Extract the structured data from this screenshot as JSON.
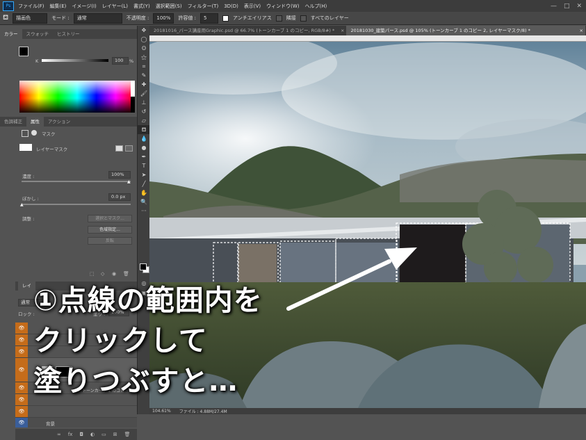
{
  "app": {
    "logo": "Ps",
    "menu": [
      "ファイル(F)",
      "編集(E)",
      "イメージ(I)",
      "レイヤー(L)",
      "書式(Y)",
      "選択範囲(S)",
      "フィルター(T)",
      "3D(D)",
      "表示(V)",
      "ウィンドウ(W)",
      "ヘルプ(H)"
    ],
    "window_buttons": [
      "—",
      "□",
      "✕"
    ]
  },
  "options": {
    "fill_source": "描画色",
    "mode_label": "モード :",
    "mode_value": "通常",
    "opacity_label": "不透明度 :",
    "opacity_value": "100%",
    "tolerance_label": "許容値 :",
    "tolerance_value": "5",
    "antialias_label": "アンチエイリアス",
    "contiguous_label": "隣接",
    "all_layers_label": "すべてのレイヤー"
  },
  "doc_tabs": [
    {
      "label": "20181016_パース講座用Graphic.psd @ 66.7% (トーンカーブ 1 のコピー, RGB/8#) *",
      "close": "×"
    },
    {
      "label": "20181030_建築パース.psd @ 105% (トーンカーブ 1 のコピー 2, レイヤーマスク/8) *",
      "close": "×"
    }
  ],
  "color_panel": {
    "tabs": [
      "カラー",
      "スウォッチ",
      "ヒストリー"
    ],
    "channel": "K",
    "value": "100",
    "unit": "%"
  },
  "properties_panel": {
    "tabs": [
      "色調補正",
      "属性",
      "アクション"
    ],
    "mode": "マスク",
    "mask_label": "レイヤーマスク",
    "density_label": "濃度 :",
    "density_value": "100%",
    "feather_label": "ぼかし :",
    "feather_value": "0.0 px",
    "refine_label": "調整 :",
    "btn_select_mask": "選択とマスク...",
    "btn_color_range": "色域指定...",
    "btn_invert": "反転"
  },
  "layers_panel": {
    "tab": "レイ",
    "blend": "通常",
    "lock_label": "ロック :",
    "fill_label": "塗り :",
    "fill_value": "100%",
    "layer_name": "トーンカーブ 1 のコピー 2",
    "background_label": "背景",
    "rows": 6
  },
  "status": {
    "zoom": "104.61%",
    "file_info": "ファイル : 4.88M/27.4M"
  },
  "overlay": {
    "line1": "①点線の範囲内を",
    "line2": "クリックして",
    "line3": "塗りつぶすと…"
  },
  "colors": {
    "accent": "#31a8ff",
    "layer_eye": "#c56c1a",
    "arrow": "#ffffff"
  }
}
